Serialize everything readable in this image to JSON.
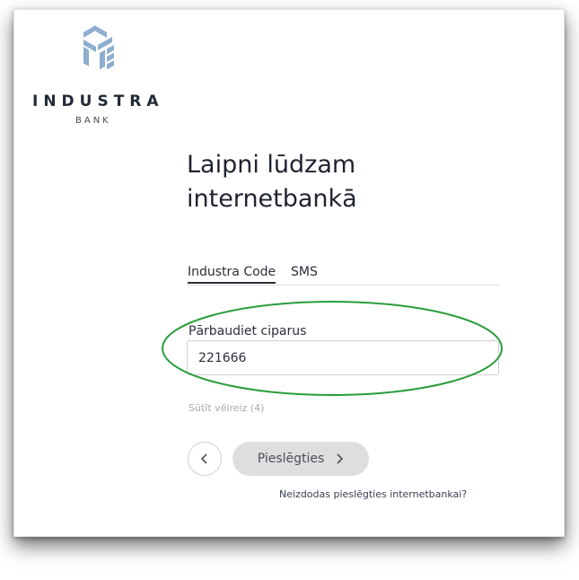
{
  "brand": {
    "name": "INDUSTRA",
    "sub": "BANK",
    "logo_icon": "industra-logo-icon",
    "logo_color": "#8eaed0"
  },
  "title": {
    "line1": "Laipni lūdzam",
    "line2": "internetbankā"
  },
  "tabs": [
    {
      "label": "Industra Code",
      "active": true
    },
    {
      "label": "SMS",
      "active": false
    }
  ],
  "code_field": {
    "label": "Pārbaudiet ciparus",
    "value": "221666"
  },
  "resend": {
    "label": "Sūtīt vēlreiz (4)"
  },
  "buttons": {
    "back_icon": "chevron-left-icon",
    "login_label": "Pieslēgties",
    "login_icon": "chevron-right-icon"
  },
  "help_link": {
    "label": "Neizdodas pieslēgties internetbankai?"
  },
  "colors": {
    "annotation_ellipse": "#2a9d3c",
    "button_disabled_bg": "#dedede",
    "text_dark": "#1f2330"
  }
}
